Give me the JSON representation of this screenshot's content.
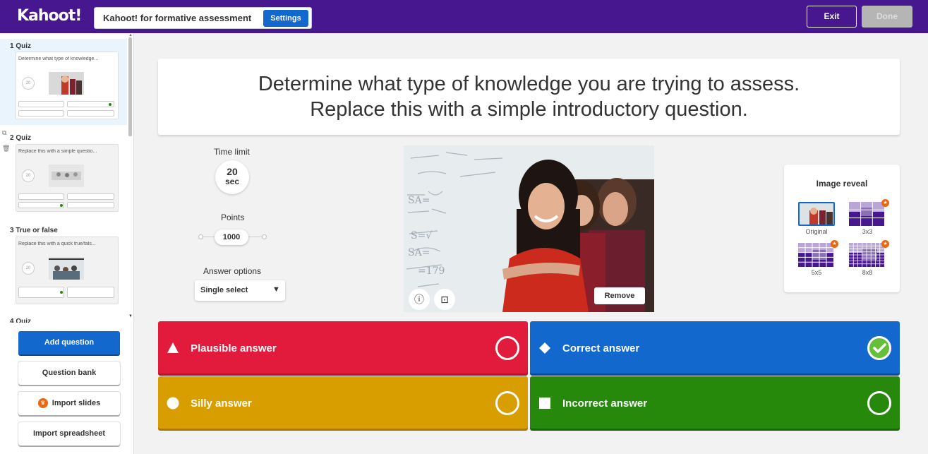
{
  "header": {
    "logo": "Kahoot!",
    "title": "Kahoot! for formative assessment",
    "settings_label": "Settings",
    "exit_label": "Exit",
    "done_label": "Done"
  },
  "sidebar": {
    "slides": [
      {
        "number_type": "1  Quiz",
        "question": "Determine what type of knowledge...",
        "timer": "20"
      },
      {
        "number_type": "2  Quiz",
        "question": "Replace this with a simple questio...",
        "timer": "20"
      },
      {
        "number_type": "3  True or false",
        "question": "Replace this with a quick true/fals...",
        "timer": "20"
      },
      {
        "number_type": "4  Quiz"
      }
    ],
    "add_question_label": "Add question",
    "question_bank_label": "Question bank",
    "import_slides_label": "Import slides",
    "import_spreadsheet_label": "Import spreadsheet"
  },
  "question": {
    "text_line1": "Determine what type of knowledge you are trying to assess.",
    "text_line2": "Replace this with a simple introductory question."
  },
  "settings": {
    "time_limit_label": "Time limit",
    "time_value": "20",
    "time_unit": "sec",
    "points_label": "Points",
    "points_value": "1000",
    "answer_options_label": "Answer options",
    "answer_options_value": "Single select"
  },
  "image": {
    "remove_label": "Remove"
  },
  "image_reveal": {
    "title": "Image reveal",
    "options": [
      "Original",
      "3x3",
      "5x5",
      "8x8"
    ],
    "selected": "Original"
  },
  "answers": [
    {
      "text": "Plausible answer",
      "color": "#e21b3c",
      "shape": "triangle",
      "correct": false
    },
    {
      "text": "Correct answer",
      "color": "#1368ce",
      "shape": "diamond",
      "correct": true
    },
    {
      "text": "Silly answer",
      "color": "#d89e00",
      "shape": "circle",
      "correct": false
    },
    {
      "text": "Incorrect answer",
      "color": "#26890c",
      "shape": "square",
      "correct": false
    }
  ],
  "colors": {
    "brand_purple": "#46178f",
    "primary_blue": "#1368ce",
    "correct_green": "#66bf39",
    "premium_orange": "#eb670f"
  }
}
